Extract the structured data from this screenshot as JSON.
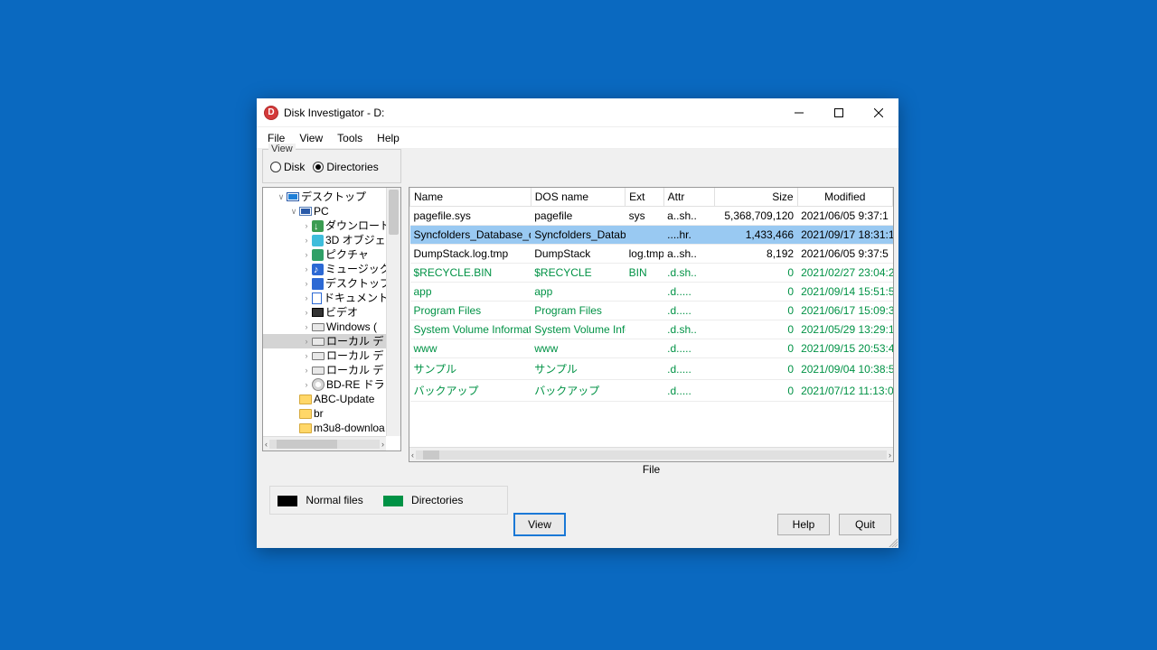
{
  "window": {
    "title": "Disk Investigator - D:"
  },
  "menu": {
    "file": "File",
    "view": "View",
    "tools": "Tools",
    "help": "Help"
  },
  "viewgroup": {
    "legend": "View",
    "disk": "Disk",
    "directories": "Directories"
  },
  "tree": {
    "items": [
      {
        "ind": 1,
        "tw": "∨",
        "icon": "monitor",
        "label": "デスクトップ"
      },
      {
        "ind": 2,
        "tw": "∨",
        "icon": "pc",
        "label": "PC"
      },
      {
        "ind": 3,
        "tw": "›",
        "icon": "dl",
        "label": "ダウンロード"
      },
      {
        "ind": 3,
        "tw": "›",
        "icon": "obj3d",
        "label": "3D オブジェ"
      },
      {
        "ind": 3,
        "tw": "›",
        "icon": "pic",
        "label": "ピクチャ"
      },
      {
        "ind": 3,
        "tw": "›",
        "icon": "music",
        "label": "ミュージック"
      },
      {
        "ind": 3,
        "tw": "›",
        "icon": "desk",
        "label": "デスクトップ"
      },
      {
        "ind": 3,
        "tw": "›",
        "icon": "doc",
        "label": "ドキュメント"
      },
      {
        "ind": 3,
        "tw": "›",
        "icon": "video",
        "label": "ビデオ"
      },
      {
        "ind": 3,
        "tw": "›",
        "icon": "drive",
        "label": "Windows ("
      },
      {
        "ind": 3,
        "tw": "›",
        "icon": "drive",
        "label": "ローカル デ",
        "sel": true
      },
      {
        "ind": 3,
        "tw": "›",
        "icon": "drive",
        "label": "ローカル デ"
      },
      {
        "ind": 3,
        "tw": "›",
        "icon": "drive",
        "label": "ローカル デ"
      },
      {
        "ind": 3,
        "tw": "›",
        "icon": "disc",
        "label": "BD-RE ドラ"
      },
      {
        "ind": 2,
        "tw": "",
        "icon": "folder",
        "label": "ABC-Update"
      },
      {
        "ind": 2,
        "tw": "",
        "icon": "folder",
        "label": "br"
      },
      {
        "ind": 2,
        "tw": "",
        "icon": "folder",
        "label": "m3u8-downloa"
      }
    ]
  },
  "table": {
    "headers": {
      "name": "Name",
      "dos": "DOS name",
      "ext": "Ext",
      "attr": "Attr",
      "size": "Size",
      "mod": "Modified"
    },
    "rows": [
      {
        "t": "file",
        "name": "pagefile.sys",
        "dos": "pagefile",
        "ext": "sys",
        "attr": "a..sh..",
        "size": "5,368,709,120",
        "mod": "2021/06/05 9:37:1"
      },
      {
        "t": "file",
        "sel": true,
        "name": "Syncfolders_Database_db",
        "dos": "Syncfolders_Databas",
        "ext": "",
        "attr": "....hr.",
        "size": "1,433,466",
        "mod": "2021/09/17 18:31:1"
      },
      {
        "t": "file",
        "name": "DumpStack.log.tmp",
        "dos": "DumpStack",
        "ext": "log.tmp",
        "attr": "a..sh..",
        "size": "8,192",
        "mod": "2021/06/05 9:37:5"
      },
      {
        "t": "dir",
        "name": "$RECYCLE.BIN",
        "dos": "$RECYCLE",
        "ext": "BIN",
        "attr": ".d.sh..",
        "size": "0",
        "mod": "2021/02/27 23:04:2"
      },
      {
        "t": "dir",
        "name": "app",
        "dos": "app",
        "ext": "",
        "attr": ".d.....",
        "size": "0",
        "mod": "2021/09/14 15:51:5"
      },
      {
        "t": "dir",
        "name": "Program Files",
        "dos": "Program Files",
        "ext": "",
        "attr": ".d.....",
        "size": "0",
        "mod": "2021/06/17 15:09:3"
      },
      {
        "t": "dir",
        "name": "System Volume Information",
        "dos": "System Volume Infor",
        "ext": "",
        "attr": ".d.sh..",
        "size": "0",
        "mod": "2021/05/29 13:29:1"
      },
      {
        "t": "dir",
        "name": "www",
        "dos": "www",
        "ext": "",
        "attr": ".d.....",
        "size": "0",
        "mod": "2021/09/15 20:53:4"
      },
      {
        "t": "dir",
        "name": "サンプル",
        "dos": "サンプル",
        "ext": "",
        "attr": ".d.....",
        "size": "0",
        "mod": "2021/09/04 10:38:5"
      },
      {
        "t": "dir",
        "name": "バックアップ",
        "dos": "バックアップ",
        "ext": "",
        "attr": ".d.....",
        "size": "0",
        "mod": "2021/07/12 11:13:0"
      }
    ],
    "caption": "File"
  },
  "legend": {
    "normal": "Normal files",
    "dirs": "Directories"
  },
  "buttons": {
    "view": "View",
    "help": "Help",
    "quit": "Quit"
  }
}
